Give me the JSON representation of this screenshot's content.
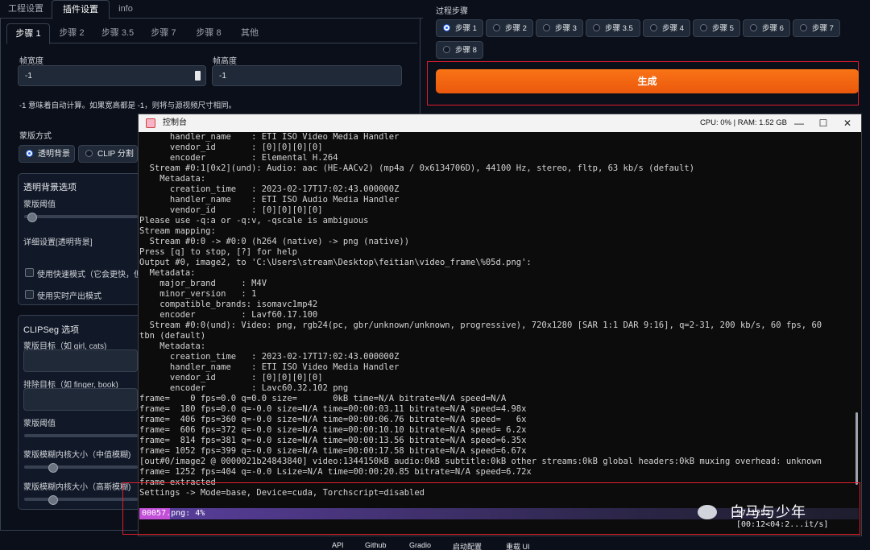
{
  "top_tabs": [
    "工程设置",
    "插件设置",
    "info"
  ],
  "sub_tabs": [
    "步骤 1",
    "步骤 2",
    "步骤 3.5",
    "步骤 7",
    "步骤 8",
    "其他"
  ],
  "frame_width": {
    "label": "帧宽度",
    "value": "-1"
  },
  "frame_height": {
    "label": "帧高度",
    "value": "-1"
  },
  "size_hint": "-1 意味着自动计算。如果宽高都是 -1，则将与源视频尺寸相同。",
  "mask_mode": {
    "label": "蒙版方式",
    "options": [
      "透明背景",
      "CLIP 分割"
    ],
    "selected": "透明背景"
  },
  "transparent_group": {
    "title": "透明背景选项",
    "threshold_label": "蒙版阈值",
    "detail_label": "详细设置[透明背景]",
    "fast_mode_label": "使用快速模式（它会更快，但",
    "realtime_label": "使用实时产出模式"
  },
  "clipseg_group": {
    "title": "CLIPSeg 选项",
    "target_label": "蒙版目标（如 girl, cats)",
    "exclude_label": "排除目标（如 finger, book)",
    "threshold_label": "蒙版阈值",
    "median_label": "蒙版模糊内核大小（中值模糊)",
    "gauss_label": "蒙版模糊内核大小（高斯模糊)"
  },
  "process_steps": {
    "label": "过程步骤",
    "options": [
      "步骤 1",
      "步骤 2",
      "步骤 3",
      "步骤 3.5",
      "步骤 4",
      "步骤 5",
      "步骤 6",
      "步骤 7",
      "步骤 8"
    ],
    "selected": "步骤 1"
  },
  "generate_label": "生成",
  "console": {
    "title": "控制台",
    "stats": "CPU: 0% | RAM: 1.52 GB",
    "minimize": "—",
    "maximize": "☐",
    "close": "✕",
    "lines": [
      "      handler_name    : ETI ISO Video Media Handler",
      "      vendor_id       : [0][0][0][0]",
      "      encoder         : Elemental H.264",
      "  Stream #0:1[0x2](und): Audio: aac (HE-AACv2) (mp4a / 0x6134706D), 44100 Hz, stereo, fltp, 63 kb/s (default)",
      "    Metadata:",
      "      creation_time   : 2023-02-17T17:02:43.000000Z",
      "      handler_name    : ETI ISO Audio Media Handler",
      "      vendor_id       : [0][0][0][0]",
      "Please use -q:a or -q:v, -qscale is ambiguous",
      "Stream mapping:",
      "  Stream #0:0 -> #0:0 (h264 (native) -> png (native))",
      "Press [q] to stop, [?] for help",
      "Output #0, image2, to 'C:\\Users\\stream\\Desktop\\feitian\\video_frame\\%05d.png':",
      "  Metadata:",
      "    major_brand     : M4V",
      "    minor_version   : 1",
      "    compatible_brands: isomavc1mp42",
      "    encoder         : Lavf60.17.100",
      "  Stream #0:0(und): Video: png, rgb24(pc, gbr/unknown/unknown, progressive), 720x1280 [SAR 1:1 DAR 9:16], q=2-31, 200 kb/s, 60 fps, 60",
      "tbn (default)",
      "    Metadata:",
      "      creation_time   : 2023-02-17T17:02:43.000000Z",
      "      handler_name    : ETI ISO Video Media Handler",
      "      vendor_id       : [0][0][0][0]",
      "      encoder         : Lavc60.32.102 png",
      "frame=    0 fps=0.0 q=0.0 size=       0kB time=N/A bitrate=N/A speed=N/A",
      "frame=  180 fps=0.0 q=-0.0 size=N/A time=00:00:03.11 bitrate=N/A speed=4.98x",
      "frame=  406 fps=360 q=-0.0 size=N/A time=00:00:06.76 bitrate=N/A speed=   6x",
      "frame=  606 fps=372 q=-0.0 size=N/A time=00:00:10.10 bitrate=N/A speed= 6.2x",
      "frame=  814 fps=381 q=-0.0 size=N/A time=00:00:13.56 bitrate=N/A speed=6.35x",
      "frame= 1052 fps=399 q=-0.0 size=N/A time=00:00:17.58 bitrate=N/A speed=6.67x",
      "[out#0/image2 @ 0000021b24843840] video:1344150kB audio:0kB subtitle:0kB other streams:0kB global headers:0kB muxing overhead: unknown",
      "frame= 1252 fps=404 q=-0.0 Lsize=N/A time=00:00:20.85 bitrate=N/A speed=6.72x",
      "frame extracted",
      "Settings -> Mode=base, Device=cuda, Torchscript=disabled"
    ],
    "progress": {
      "file": "00057.png: 4%",
      "percent": 4,
      "right": "57/1252 [00:12<04:2...it/s]"
    }
  },
  "watermark": "白马与少年",
  "footer_links": [
    "API",
    "Github",
    "Gradio",
    "启动配置",
    "重载 UI"
  ],
  "colors": {
    "accent": "#2563eb",
    "generate": "#f97316",
    "highlight": "#e11d2e",
    "progress": "#c24fd8"
  }
}
